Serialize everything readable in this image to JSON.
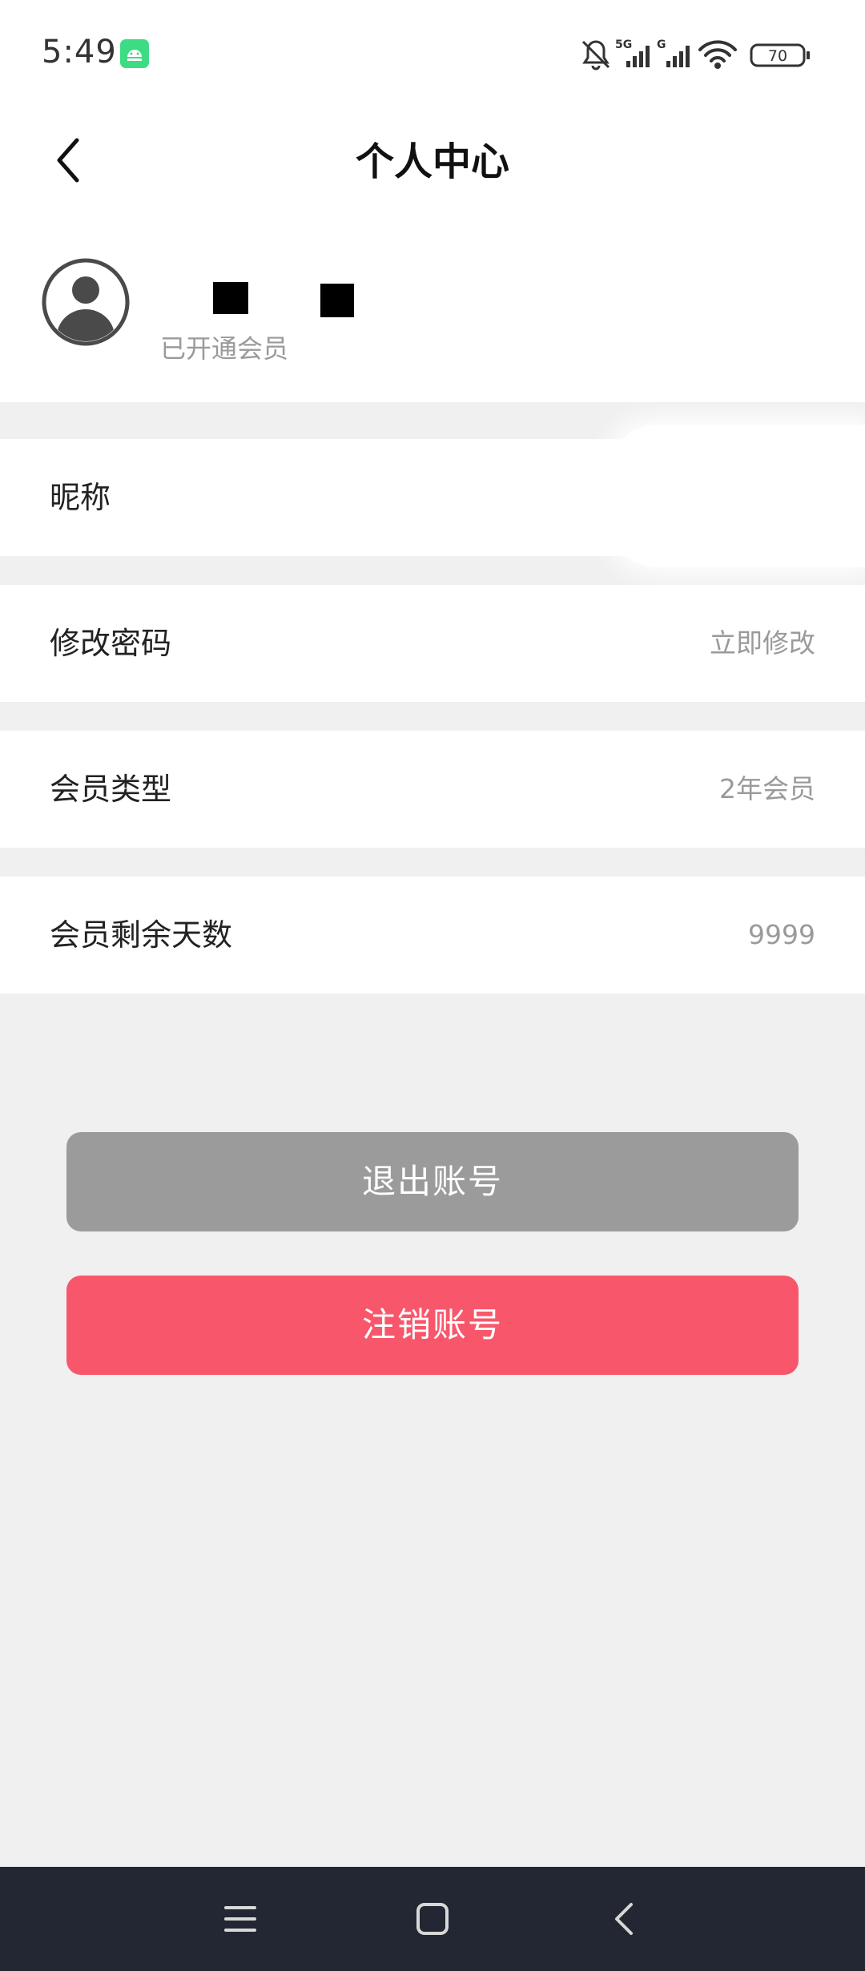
{
  "status_bar": {
    "time": "5:49",
    "battery": "70",
    "network_label_1": "5G",
    "network_label_2": "G",
    "icons": [
      "android-notification-icon",
      "bell-muted-icon",
      "signal-5g-icon",
      "signal-g-icon",
      "wifi-icon",
      "battery-icon"
    ]
  },
  "header": {
    "title": "个人中心",
    "back_icon": "chevron-left-icon"
  },
  "profile": {
    "member_status": "已开通会员",
    "avatar_icon": "user-avatar-icon"
  },
  "rows": [
    {
      "label": "昵称",
      "value": ""
    },
    {
      "label": "修改密码",
      "value": "立即修改"
    },
    {
      "label": "会员类型",
      "value": "2年会员"
    },
    {
      "label": "会员剩余天数",
      "value": "9999"
    }
  ],
  "buttons": {
    "logout": "退出账号",
    "cancel_account": "注销账号"
  },
  "colors": {
    "logout_button": "#9b9b9b",
    "cancel_button": "#f8576b",
    "page_background": "#f0f0f0",
    "nav_bar": "#232733"
  },
  "system_nav": {
    "icons": [
      "menu-icon",
      "home-icon",
      "back-icon"
    ]
  }
}
